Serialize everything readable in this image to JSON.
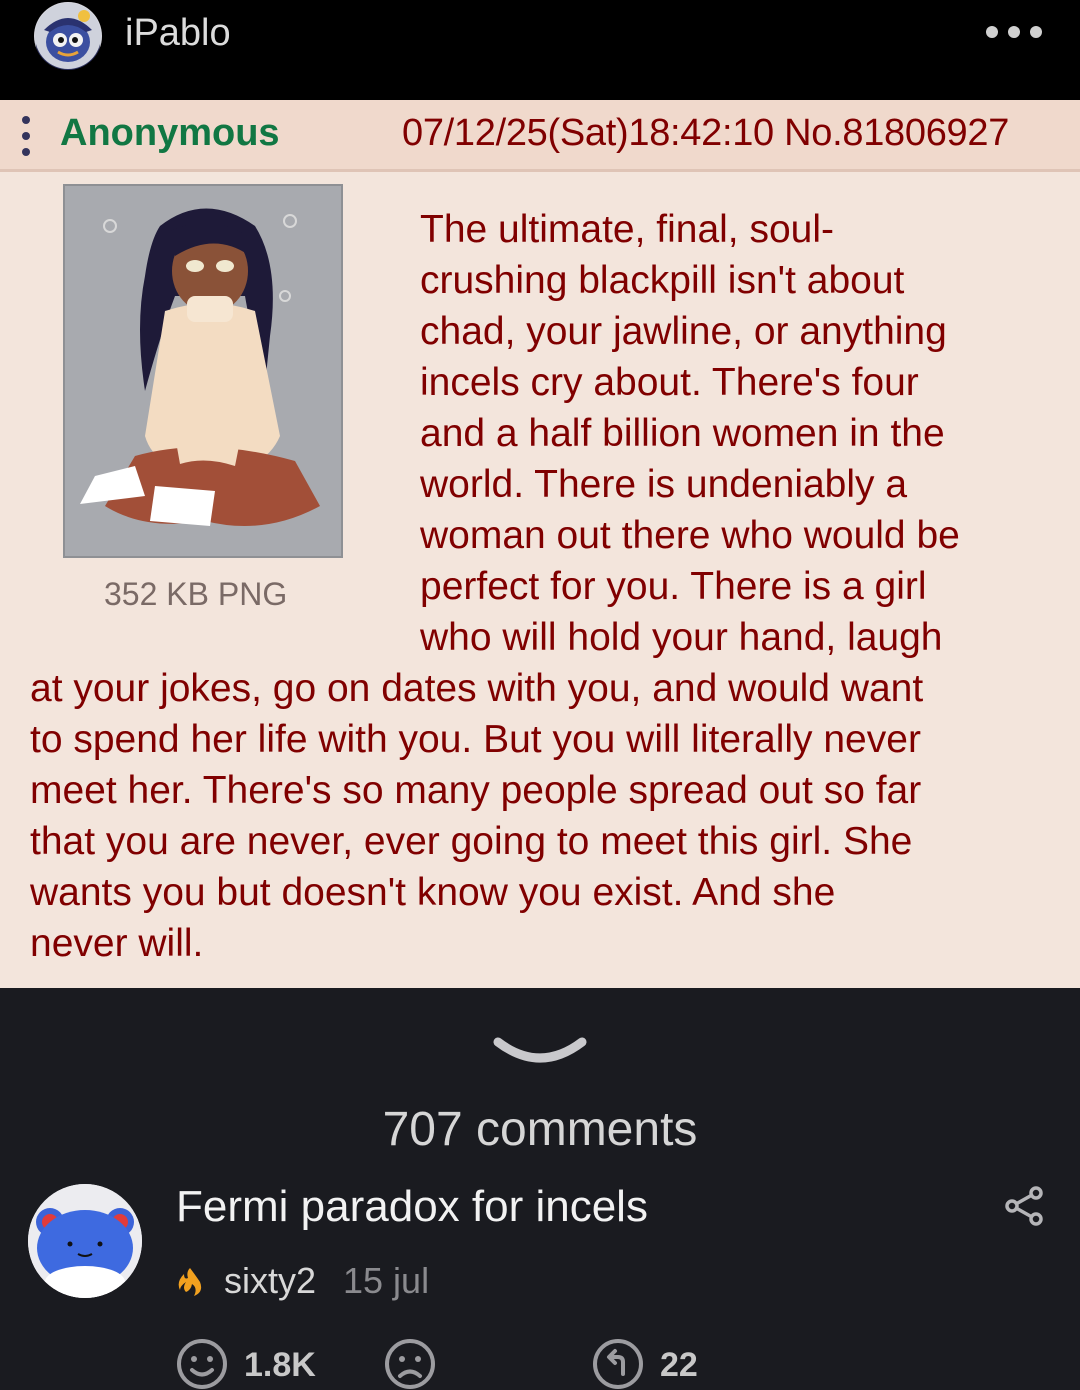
{
  "header": {
    "username": "iPablo",
    "avatar_icon": "cartoon-avatar-icon",
    "more_icon": "more-dots-icon"
  },
  "post": {
    "name": "Anonymous",
    "meta": "07/12/25(Sat)18:42:10 No.81806927",
    "file_info": "352 KB PNG",
    "lines": [
      "The ultimate, final, soul-",
      "crushing blackpill isn't about",
      "chad, your jawline, or anything",
      "incels cry about. There's four",
      "and a half billion women in the",
      "world. There is undeniably a",
      "woman out there who would be",
      "perfect for you. There is a girl",
      "who will hold your hand, laugh",
      "at your jokes, go on dates with you, and would want",
      "to spend her life with you. But you will literally never",
      "meet her. There's so many people spread out so far",
      "that you are never, ever going to meet this girl. She",
      "wants you but doesn't know you exist. And she",
      "never will."
    ],
    "colors": {
      "background": "#f3e5dc",
      "header": "#f0d9cc",
      "name": "#117743",
      "text": "#800000"
    }
  },
  "comments": {
    "count_label": "707 comments"
  },
  "card": {
    "title": "Fermi paradox for incels",
    "author": "sixty2",
    "date": "15 jul",
    "likes": "1.8K",
    "replies": "22",
    "share_icon": "share-icon",
    "author_badge_icon": "fire-icon"
  }
}
